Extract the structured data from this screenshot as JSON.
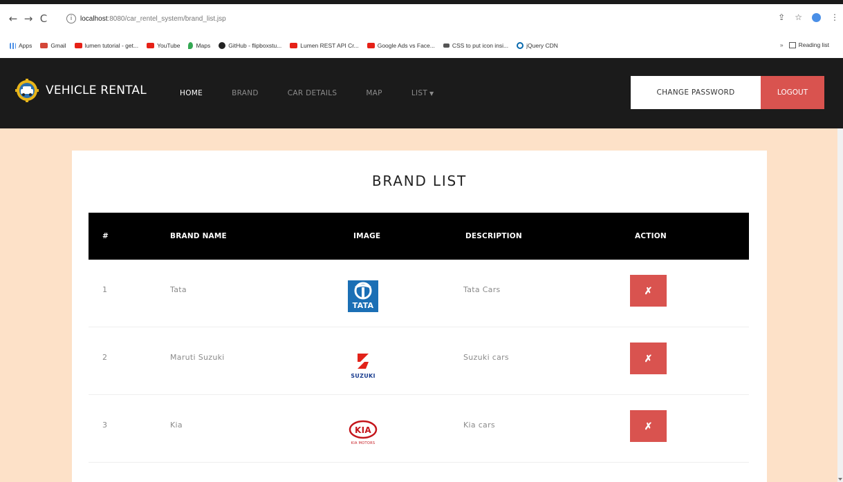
{
  "browser": {
    "url_host": "localhost",
    "url_path": ":8080/car_rentel_system/brand_list.jsp",
    "bookmarks": [
      {
        "label": "Apps",
        "icon": "apps-grid-icon"
      },
      {
        "label": "Gmail",
        "icon": "gmail-icon"
      },
      {
        "label": "lumen tutorial - get...",
        "icon": "youtube-icon"
      },
      {
        "label": "YouTube",
        "icon": "youtube-icon"
      },
      {
        "label": "Maps",
        "icon": "maps-pin-icon"
      },
      {
        "label": "GitHub - flipboxstu...",
        "icon": "github-icon"
      },
      {
        "label": "Lumen REST API Cr...",
        "icon": "youtube-icon"
      },
      {
        "label": "Google Ads vs Face...",
        "icon": "youtube-icon"
      },
      {
        "label": "CSS to put icon insi...",
        "icon": "css-icon"
      },
      {
        "label": "jQuery CDN",
        "icon": "jquery-icon"
      }
    ],
    "bookmarks_more": "»",
    "reading_list": "Reading list"
  },
  "navbar": {
    "brand": "VEHICLE RENTAL",
    "links": {
      "home": "HOME",
      "brand": "BRAND",
      "car_details": "CAR DETAILS",
      "map": "MAP",
      "list": "LIST"
    },
    "change_password": "CHANGE PASSWORD",
    "logout": "LOGOUT"
  },
  "page": {
    "title": "BRAND LIST"
  },
  "table": {
    "headers": {
      "num": "#",
      "name": "BRAND NAME",
      "image": "IMAGE",
      "description": "DESCRIPTION",
      "action": "ACTION"
    },
    "rows": [
      {
        "num": "1",
        "name": "Tata",
        "logo": "tata-logo",
        "description": "Tata Cars"
      },
      {
        "num": "2",
        "name": "Maruti Suzuki",
        "logo": "suzuki-logo",
        "description": "Suzuki cars"
      },
      {
        "num": "3",
        "name": "Kia",
        "logo": "kia-logo",
        "description": "Kia cars"
      }
    ],
    "delete_label": "✗"
  },
  "logo_text": {
    "tata": "TATA",
    "suzuki": "SUZUKI",
    "kia": "KIA",
    "kia_sub": "KIA MOTORS"
  },
  "colors": {
    "navbar_bg": "#1b1b1b",
    "content_bg": "#fde1c8",
    "danger": "#d9534f",
    "table_head": "#000000"
  }
}
